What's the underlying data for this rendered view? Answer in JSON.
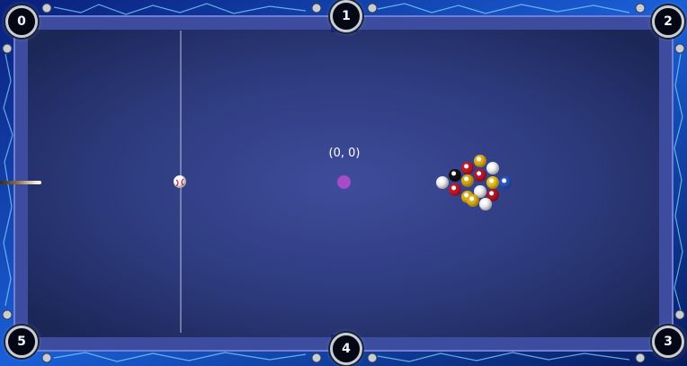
{
  "table": {
    "felt_color": "#2e3a80",
    "rail_color": "#3d4c9e",
    "frame_color": "#0a2a8a",
    "origin_label": "(0, 0)"
  },
  "pockets": [
    {
      "label": "0"
    },
    {
      "label": "1"
    },
    {
      "label": "2"
    },
    {
      "label": "3"
    },
    {
      "label": "4"
    },
    {
      "label": "5"
    }
  ],
  "balls": {
    "cue_ball_color": "#f2f2f2",
    "rack_colors": [
      "#e3b21a",
      "#c51b2a",
      "#f2f2f2",
      "#111111",
      "#d8a916",
      "#b81830",
      "#e8c11f",
      "#f2f2f2",
      "#c21a2c",
      "#dcae17",
      "#f2f2f2",
      "#b0162a",
      "#2a56c7",
      "#e0b21b",
      "#f2f2f2"
    ]
  }
}
